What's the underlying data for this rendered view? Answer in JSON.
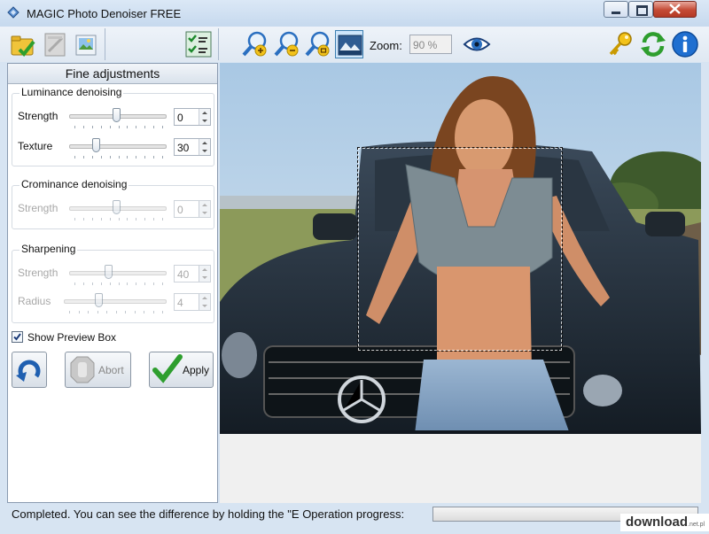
{
  "window": {
    "title": "MAGIC Photo Denoiser FREE"
  },
  "toolbar": {
    "zoom_label": "Zoom:",
    "zoom_value": "90 %",
    "buttons": [
      "open-icon",
      "save-icon",
      "image-file-icon",
      "compare-icon",
      "zoom-in-icon",
      "zoom-out-icon",
      "zoom-fit-icon",
      "actual-size-icon",
      "eye-icon",
      "key-icon",
      "refresh-icon",
      "info-icon"
    ]
  },
  "panel": {
    "title": "Fine adjustments",
    "luminance": {
      "title": "Luminance denoising",
      "strength_label": "Strength",
      "strength_value": "0",
      "texture_label": "Texture",
      "texture_value": "30"
    },
    "crominance": {
      "title": "Crominance denoising",
      "strength_label": "Strength",
      "strength_value": "0"
    },
    "sharpening": {
      "title": "Sharpening",
      "strength_label": "Strength",
      "strength_value": "40",
      "radius_label": "Radius",
      "radius_value": "4"
    },
    "show_preview_label": "Show Preview Box",
    "show_preview_checked": true,
    "abort_label": "Abort",
    "apply_label": "Apply"
  },
  "status": {
    "message": "Completed. You can see the difference by holding the \"E",
    "progress_label": "Operation progress:",
    "progress_fraction": 0
  },
  "watermark": {
    "text": "download",
    "suffix": ".net.pl"
  },
  "colors": {
    "title_bar": "#c6d9ee",
    "close_button": "#c44a35",
    "accent_blue": "#2a6fc0",
    "apply_green": "#2e9e2e"
  }
}
